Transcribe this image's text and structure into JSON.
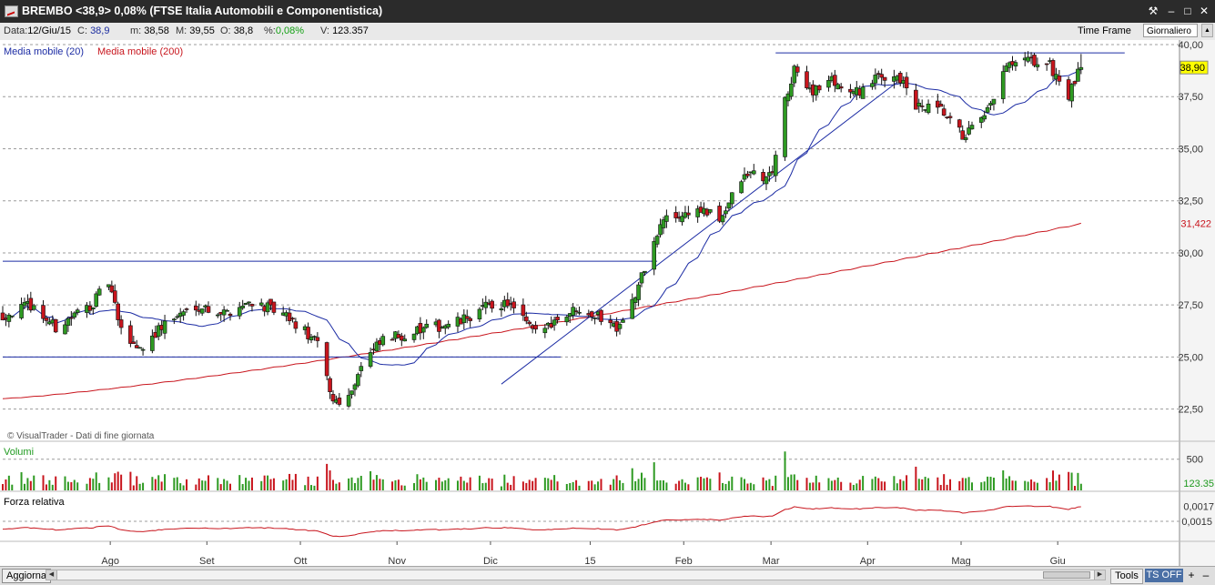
{
  "window": {
    "title": "BREMBO <38,9> 0,08%  (FTSE Italia Automobili e Componentistica)",
    "buttons": [
      "⚒",
      "–",
      "□",
      "✕"
    ]
  },
  "info_bar": {
    "date_label": "Data:",
    "date_value": "12/Giu/15",
    "close_label": "C:",
    "close_value": "38,9",
    "min_label": "m:",
    "min_value": "38,58",
    "max_label": "M:",
    "max_value": "39,55",
    "open_label": "O:",
    "open_value": "38,8",
    "pct_label": "%:",
    "pct_value": "0,08%",
    "vol_label": "V:",
    "vol_value": "123.357",
    "timeframe_label": "Time Frame",
    "timeframe_value": "Giornaliero"
  },
  "bottom_bar": {
    "refresh_label": "Aggiorna",
    "tools_label": "Tools",
    "ts_label": "TS OFF",
    "plus_label": "+",
    "minus_label": "–"
  },
  "colors": {
    "up": "#2e9a22",
    "down": "#c8151d",
    "ma20": "#1c2ca4",
    "ma200": "#c8151d",
    "grid": "#9c9c9c",
    "volume_value": "#1f9a1f",
    "last_price_bg": "#ffff00"
  },
  "chart_data": {
    "type": "candlestick",
    "legend": [
      "Media mobile (20)",
      "Media mobile (200)"
    ],
    "watermark": "© VisualTrader - Dati di fine giornata",
    "price_axis": {
      "ticks": [
        "40,00",
        "37,50",
        "35,00",
        "32,50",
        "30,00",
        "27,50",
        "25,00",
        "22,50"
      ],
      "ylim": [
        21.0,
        40.0
      ]
    },
    "last_price": "38,90",
    "ma200_value": "31,422",
    "x_axis": {
      "labels": [
        "Ago",
        "Set",
        "Ott",
        "Nov",
        "Dic",
        "15",
        "Feb",
        "Mar",
        "Apr",
        "Mag",
        "Giu"
      ]
    },
    "anchors": [
      [
        "2014-07-01",
        27.0
      ],
      [
        "2014-07-10",
        27.5
      ],
      [
        "2014-07-18",
        26.4
      ],
      [
        "2014-07-30",
        27.6
      ],
      [
        "2014-08-04",
        28.6
      ],
      [
        "2014-08-08",
        26.2
      ],
      [
        "2014-08-14",
        25.4
      ],
      [
        "2014-08-22",
        26.6
      ],
      [
        "2014-09-01",
        27.5
      ],
      [
        "2014-09-10",
        27.1
      ],
      [
        "2014-09-19",
        27.7
      ],
      [
        "2014-09-30",
        26.9
      ],
      [
        "2014-10-06",
        26.2
      ],
      [
        "2014-10-10",
        25.6
      ],
      [
        "2014-10-15",
        22.9
      ],
      [
        "2014-10-20",
        23.1
      ],
      [
        "2014-10-24",
        24.6
      ],
      [
        "2014-10-31",
        25.8
      ],
      [
        "2014-11-10",
        26.2
      ],
      [
        "2014-11-25",
        26.7
      ],
      [
        "2014-12-03",
        27.4
      ],
      [
        "2014-12-10",
        27.6
      ],
      [
        "2014-12-19",
        26.1
      ],
      [
        "2014-12-24",
        26.7
      ],
      [
        "2015-01-02",
        27.4
      ],
      [
        "2015-01-09",
        26.9
      ],
      [
        "2015-01-14",
        26.5
      ],
      [
        "2015-01-20",
        27.9
      ],
      [
        "2015-01-23",
        29.3
      ],
      [
        "2015-01-29",
        31.6
      ],
      [
        "2015-02-02",
        31.7
      ],
      [
        "2015-02-09",
        32.1
      ],
      [
        "2015-02-16",
        31.6
      ],
      [
        "2015-02-23",
        33.5
      ],
      [
        "2015-02-27",
        33.9
      ],
      [
        "2015-03-03",
        33.5
      ],
      [
        "2015-03-05",
        34.0
      ],
      [
        "2015-03-09",
        37.2
      ],
      [
        "2015-03-12",
        38.7
      ],
      [
        "2015-03-18",
        37.8
      ],
      [
        "2015-03-24",
        38.3
      ],
      [
        "2015-03-31",
        37.6
      ],
      [
        "2015-04-08",
        38.4
      ],
      [
        "2015-04-14",
        38.6
      ],
      [
        "2015-04-20",
        37.0
      ],
      [
        "2015-04-28",
        36.8
      ],
      [
        "2015-05-05",
        35.6
      ],
      [
        "2015-05-12",
        36.4
      ],
      [
        "2015-05-19",
        38.9
      ],
      [
        "2015-05-26",
        39.2
      ],
      [
        "2015-06-02",
        39.0
      ],
      [
        "2015-06-08",
        37.5
      ],
      [
        "2015-06-12",
        38.9
      ]
    ],
    "lines": [
      [
        [
          "2014-07-01",
          25.0
        ],
        [
          "2014-12-27",
          25.0
        ]
      ],
      [
        [
          "2014-07-01",
          29.6
        ],
        [
          "2015-01-27",
          29.6
        ]
      ],
      [
        [
          "2014-12-08",
          23.7
        ],
        [
          "2015-04-14",
          38.2
        ]
      ],
      [
        [
          "2015-03-06",
          39.6
        ],
        [
          "2015-06-26",
          39.6
        ]
      ]
    ],
    "volume": {
      "label": "Volumi",
      "tick": "500",
      "value": "123.35",
      "ylim": [
        0,
        700
      ]
    },
    "rs": {
      "label": "Forza relativa",
      "ticks": [
        "0,0017",
        "0,0015"
      ],
      "ylim": [
        0.00115,
        0.00185
      ]
    }
  }
}
